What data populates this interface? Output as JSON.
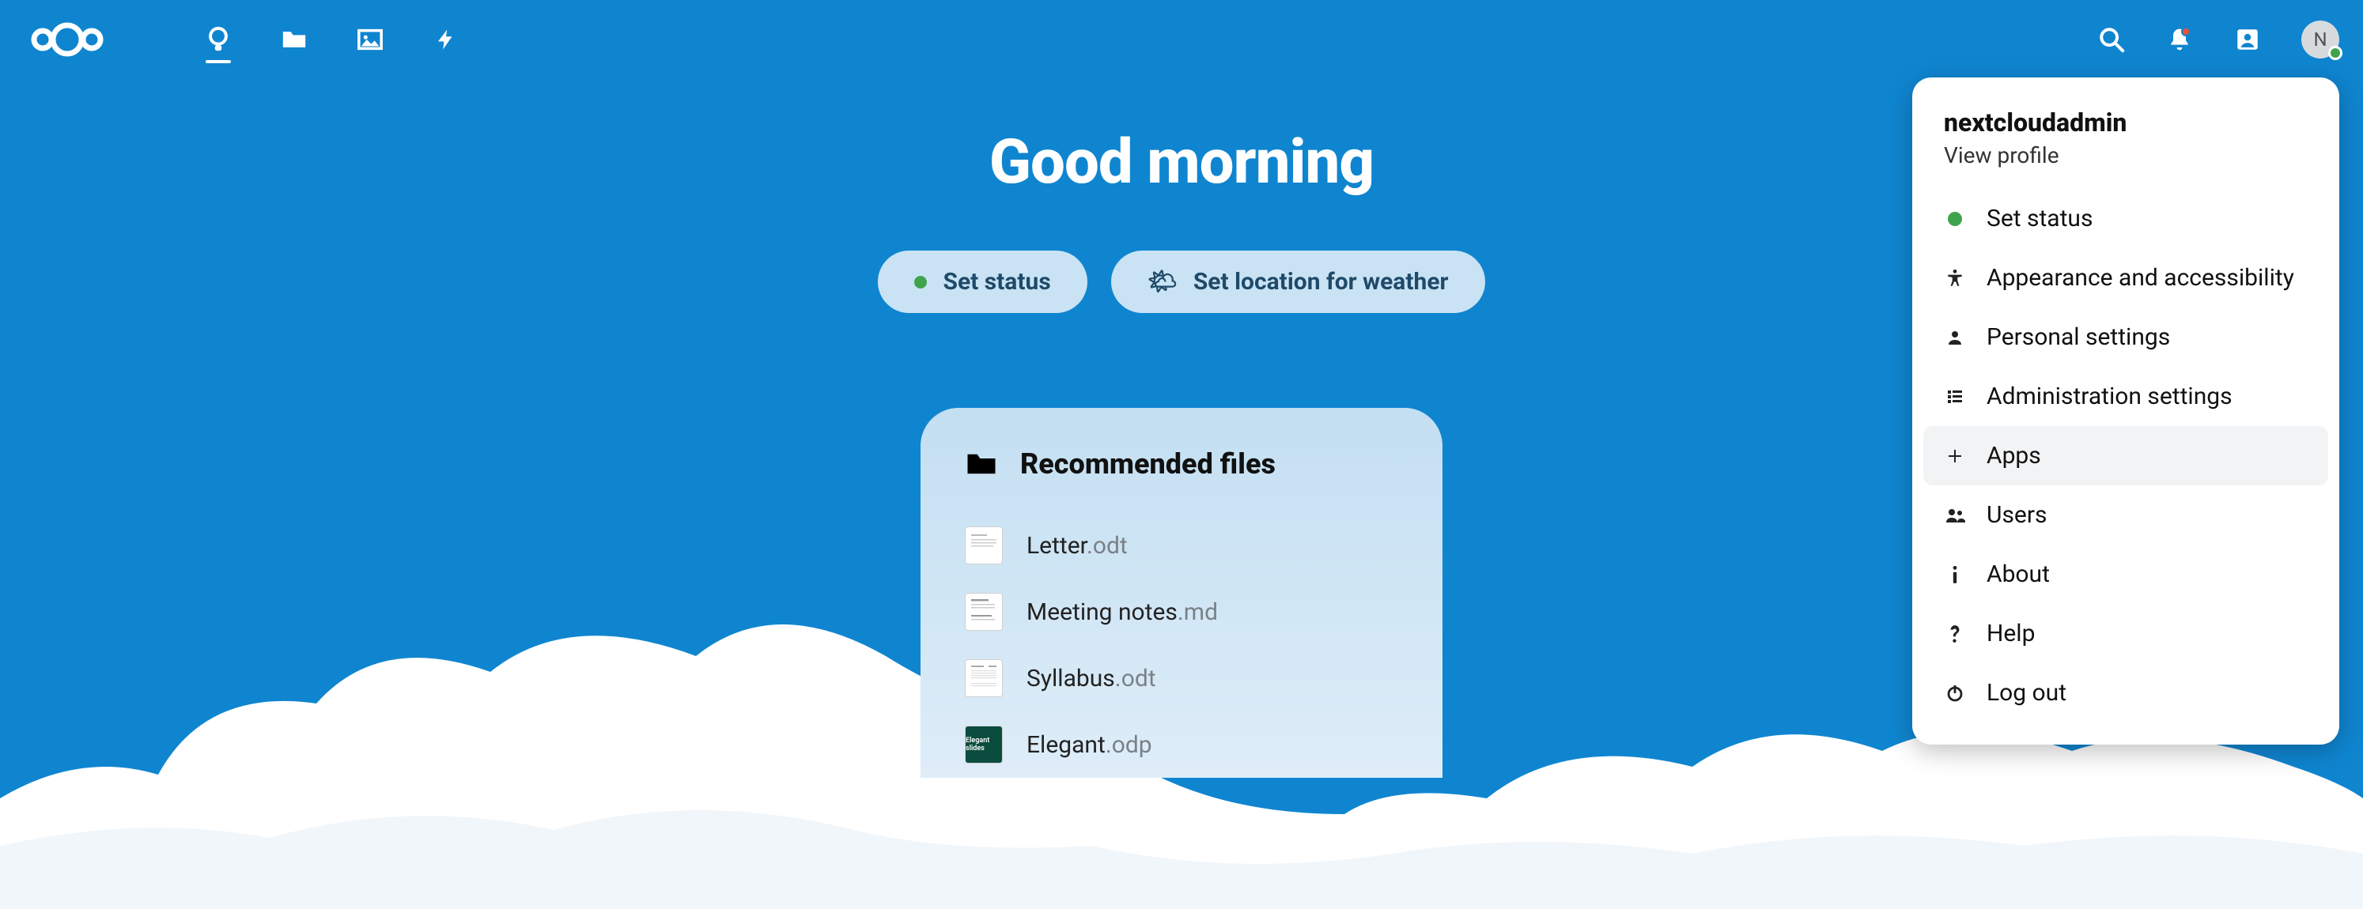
{
  "header": {
    "avatar_initial": "N"
  },
  "greeting": "Good morning",
  "chips": {
    "status": "Set status",
    "weather": "Set location for weather"
  },
  "recommended": {
    "title": "Recommended files",
    "items": [
      {
        "name": "Letter",
        "ext": ".odt",
        "thumb": "letter"
      },
      {
        "name": "Meeting notes",
        "ext": ".md",
        "thumb": "notes"
      },
      {
        "name": "Syllabus",
        "ext": ".odt",
        "thumb": "syllabus"
      },
      {
        "name": "Elegant",
        "ext": ".odp",
        "thumb": "elegant"
      }
    ]
  },
  "menu": {
    "username": "nextcloudadmin",
    "view_profile": "View profile",
    "items": [
      {
        "icon": "status",
        "label": "Set status"
      },
      {
        "icon": "accessibility",
        "label": "Appearance and accessibility"
      },
      {
        "icon": "user",
        "label": "Personal settings"
      },
      {
        "icon": "admin",
        "label": "Administration settings"
      },
      {
        "icon": "plus",
        "label": "Apps",
        "hover": true
      },
      {
        "icon": "users",
        "label": "Users"
      },
      {
        "icon": "info",
        "label": "About"
      },
      {
        "icon": "help",
        "label": "Help"
      },
      {
        "icon": "power",
        "label": "Log out"
      }
    ]
  }
}
